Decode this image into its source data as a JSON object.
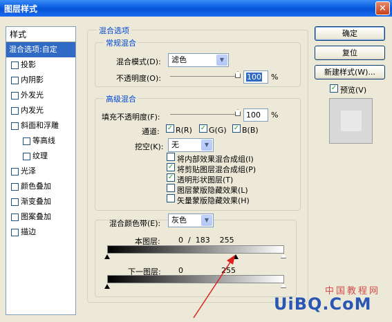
{
  "window": {
    "title": "图层样式",
    "close_glyph": "✕"
  },
  "style_list": {
    "header": "样式",
    "items": [
      {
        "label": "混合选项:自定",
        "checkbox": false,
        "selected": true,
        "indent": false
      },
      {
        "label": "投影",
        "checkbox": true,
        "selected": false,
        "indent": false
      },
      {
        "label": "内阴影",
        "checkbox": true,
        "selected": false,
        "indent": false
      },
      {
        "label": "外发光",
        "checkbox": true,
        "selected": false,
        "indent": false
      },
      {
        "label": "内发光",
        "checkbox": true,
        "selected": false,
        "indent": false
      },
      {
        "label": "斜面和浮雕",
        "checkbox": true,
        "selected": false,
        "indent": false
      },
      {
        "label": "等高线",
        "checkbox": true,
        "selected": false,
        "indent": true
      },
      {
        "label": "纹理",
        "checkbox": true,
        "selected": false,
        "indent": true
      },
      {
        "label": "光泽",
        "checkbox": true,
        "selected": false,
        "indent": false
      },
      {
        "label": "颜色叠加",
        "checkbox": true,
        "selected": false,
        "indent": false
      },
      {
        "label": "渐变叠加",
        "checkbox": true,
        "selected": false,
        "indent": false
      },
      {
        "label": "图案叠加",
        "checkbox": true,
        "selected": false,
        "indent": false
      },
      {
        "label": "描边",
        "checkbox": true,
        "selected": false,
        "indent": false
      }
    ]
  },
  "blend_options": {
    "legend": "混合选项",
    "general": {
      "legend": "常规混合",
      "mode_label": "混合模式(D):",
      "mode_value": "滤色",
      "opacity_label": "不透明度(O):",
      "opacity_value": "100",
      "opacity_unit": "%"
    },
    "advanced": {
      "legend": "高级混合",
      "fill_opacity_label": "填充不透明度(F):",
      "fill_opacity_value": "100",
      "fill_opacity_unit": "%",
      "channels_label": "通道:",
      "channel_r": "R(R)",
      "channel_g": "G(G)",
      "channel_b": "B(B)",
      "knockout_label": "挖空(K):",
      "knockout_value": "无",
      "options": [
        {
          "label": "将内部效果混合成组(I)",
          "checked": false
        },
        {
          "label": "将剪贴图层混合成组(P)",
          "checked": true
        },
        {
          "label": "透明形状图层(T)",
          "checked": true
        },
        {
          "label": "图层蒙版隐藏效果(L)",
          "checked": false
        },
        {
          "label": "矢量蒙版隐藏效果(H)",
          "checked": false
        }
      ]
    },
    "blend_if": {
      "label": "混合颜色带(E):",
      "value": "灰色",
      "this_layer_label": "本图层:",
      "this_layer_values": "0  /  183    255",
      "underlying_label": "下一图层:",
      "underlying_low": "0",
      "underlying_high": "255"
    }
  },
  "buttons": {
    "ok": "确定",
    "reset": "复位",
    "new_style": "新建样式(W)...",
    "preview_label": "预览(V)"
  },
  "watermark": {
    "main": "UiBQ.CoM",
    "sub": "中国教程网"
  },
  "colors": {
    "selection": "#316ac5",
    "legend": "#0046d5",
    "arrow": "#e02020"
  }
}
